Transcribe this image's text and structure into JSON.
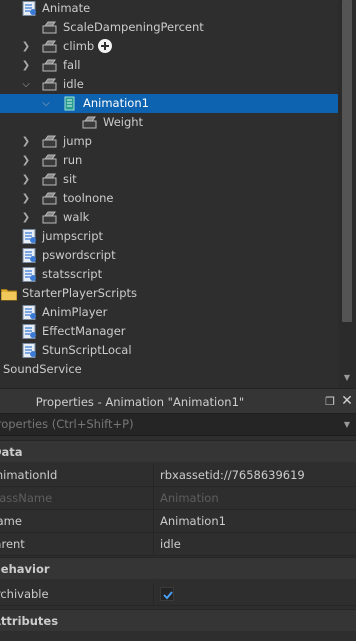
{
  "explorer": {
    "rows": [
      {
        "label": "Animate"
      },
      {
        "label": "ScaleDampeningPercent"
      },
      {
        "label": "climb"
      },
      {
        "label": "fall"
      },
      {
        "label": "idle"
      },
      {
        "label": "Animation1"
      },
      {
        "label": "Weight"
      },
      {
        "label": "jump"
      },
      {
        "label": "run"
      },
      {
        "label": "sit"
      },
      {
        "label": "toolnone"
      },
      {
        "label": "walk"
      },
      {
        "label": "jumpscript"
      },
      {
        "label": "pswordscript"
      },
      {
        "label": "statsscript"
      },
      {
        "label": "StarterPlayerScripts"
      },
      {
        "label": "AnimPlayer"
      },
      {
        "label": "EffectManager"
      },
      {
        "label": "StunScriptLocal"
      },
      {
        "label": "SoundService"
      }
    ]
  },
  "properties": {
    "title": "Properties - Animation \"Animation1\"",
    "filter_placeholder": "Properties (Ctrl+Shift+P)",
    "categories": [
      {
        "label": "Data"
      },
      {
        "label": "Behavior"
      },
      {
        "label": "Attributes"
      }
    ],
    "rows": [
      {
        "key": "AnimationId",
        "value": "rbxassetid://7658639619"
      },
      {
        "key": "ClassName",
        "value": "Animation"
      },
      {
        "key": "Name",
        "value": "Animation1"
      },
      {
        "key": "Parent",
        "value": "idle"
      },
      {
        "key": "Archivable",
        "value": "checked"
      }
    ]
  },
  "colors": {
    "selection": "#0e63b1",
    "background": "#2e2e2e",
    "checkmark": "#4aa3ff"
  }
}
